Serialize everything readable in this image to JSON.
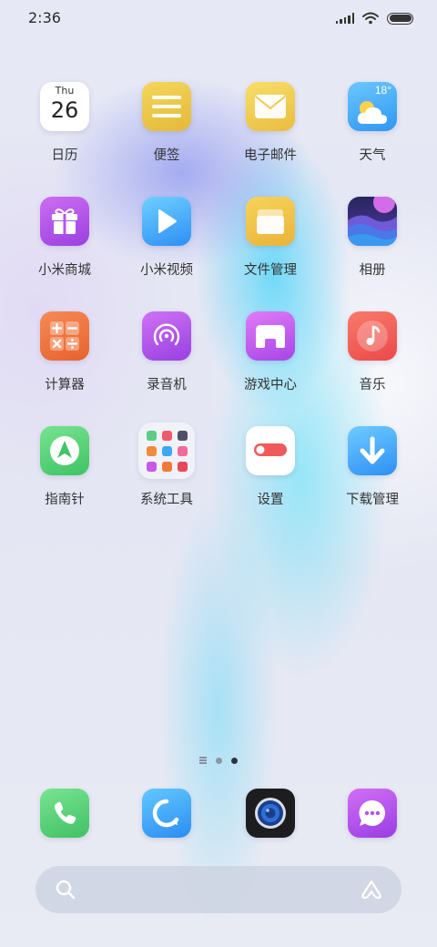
{
  "status_bar": {
    "time": "2:36",
    "icons": [
      "signal-icon",
      "wifi-icon",
      "battery-icon"
    ]
  },
  "apps": [
    {
      "label": "日历",
      "icon": "calendar-icon",
      "calendar_weekday": "Thu",
      "calendar_date": "26"
    },
    {
      "label": "便签",
      "icon": "notes-icon"
    },
    {
      "label": "电子邮件",
      "icon": "mail-icon"
    },
    {
      "label": "天气",
      "icon": "weather-icon",
      "temperature": "18°"
    },
    {
      "label": "小米商城",
      "icon": "gift-icon"
    },
    {
      "label": "小米视频",
      "icon": "play-icon"
    },
    {
      "label": "文件管理",
      "icon": "folder-icon"
    },
    {
      "label": "相册",
      "icon": "gallery-icon"
    },
    {
      "label": "计算器",
      "icon": "calculator-icon"
    },
    {
      "label": "录音机",
      "icon": "recorder-icon"
    },
    {
      "label": "游戏中心",
      "icon": "gamepad-icon"
    },
    {
      "label": "音乐",
      "icon": "music-note-icon"
    },
    {
      "label": "指南针",
      "icon": "compass-icon"
    },
    {
      "label": "系统工具",
      "icon": "app-folder-icon"
    },
    {
      "label": "设置",
      "icon": "toggle-settings-icon"
    },
    {
      "label": "下载管理",
      "icon": "download-arrow-icon"
    }
  ],
  "page_indicator": {
    "pages": 2,
    "active_page": 2
  },
  "dock": [
    {
      "icon": "phone-icon"
    },
    {
      "icon": "browser-icon"
    },
    {
      "icon": "camera-icon"
    },
    {
      "icon": "messages-icon"
    }
  ],
  "search_bar": {
    "placeholder": "",
    "icons": [
      "search-icon",
      "xiaoai-assistant-icon"
    ]
  },
  "colors": {
    "label_text": "#333333",
    "calendar_bg": "#ffffff",
    "notes": "#f3d65a",
    "mail": "#f7de6a",
    "weather": "#3aa2f4",
    "shop": "#b656ea",
    "video": "#4ab0fa",
    "music": "#ef5b55",
    "compass": "#4ecb70",
    "settings_toggle": "#f05a5a"
  }
}
